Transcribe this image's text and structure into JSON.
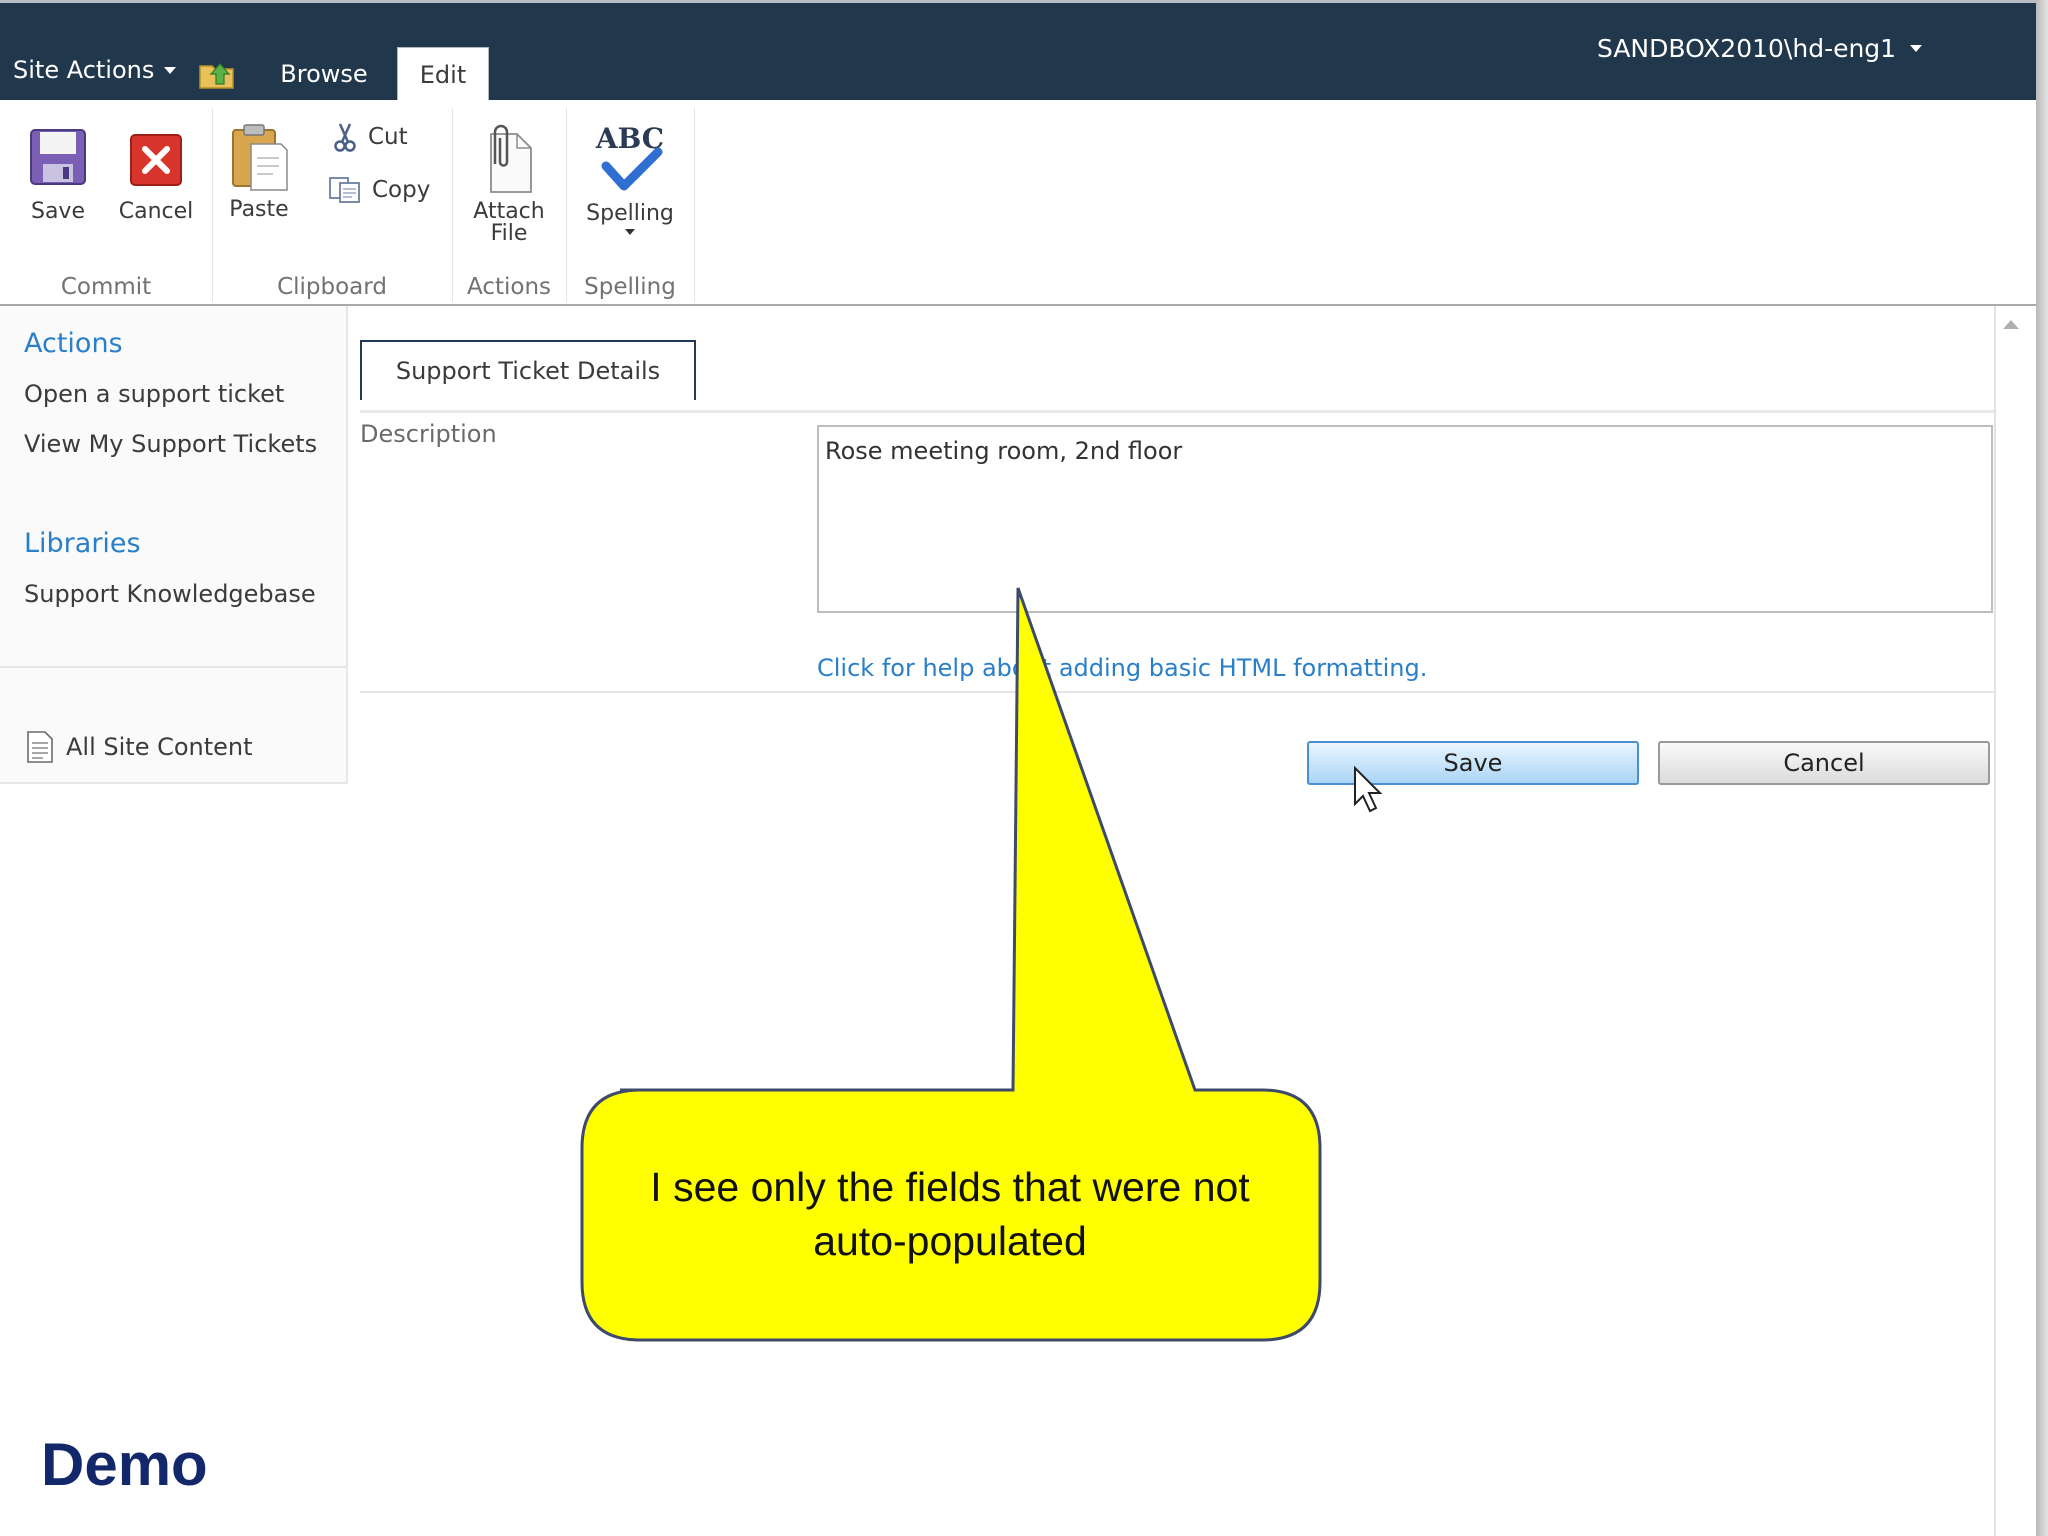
{
  "topbar": {
    "site_actions": "Site Actions",
    "tabs": [
      "Browse",
      "Edit"
    ],
    "user": "SANDBOX2010\\hd-eng1"
  },
  "ribbon": {
    "groups": [
      "Commit",
      "Clipboard",
      "Actions",
      "Spelling"
    ],
    "save": "Save",
    "cancel": "Cancel",
    "paste": "Paste",
    "cut": "Cut",
    "copy": "Copy",
    "attach_line1": "Attach",
    "attach_line2": "File",
    "spelling": "Spelling",
    "spelling_icon_text": "ABC"
  },
  "leftnav": {
    "actions_heading": "Actions",
    "actions": [
      "Open a support ticket",
      "View My Support Tickets"
    ],
    "libraries_heading": "Libraries",
    "libraries": [
      "Support Knowledgebase"
    ],
    "all_site_content": "All Site Content"
  },
  "form": {
    "tab_label": "Support Ticket Details",
    "description_label": "Description",
    "description_value": "Rose meeting room, 2nd floor",
    "help_link": "Click for help about adding basic HTML formatting.",
    "save_button": "Save",
    "cancel_button": "Cancel"
  },
  "callout": {
    "line1": "I see only the fields that were not",
    "line2": "auto-populated",
    "fill": "#ffff00"
  },
  "slide_label": "Demo",
  "colors": {
    "topbar": "#21374c",
    "link": "#2a7fc9",
    "demo": "#13286b"
  }
}
